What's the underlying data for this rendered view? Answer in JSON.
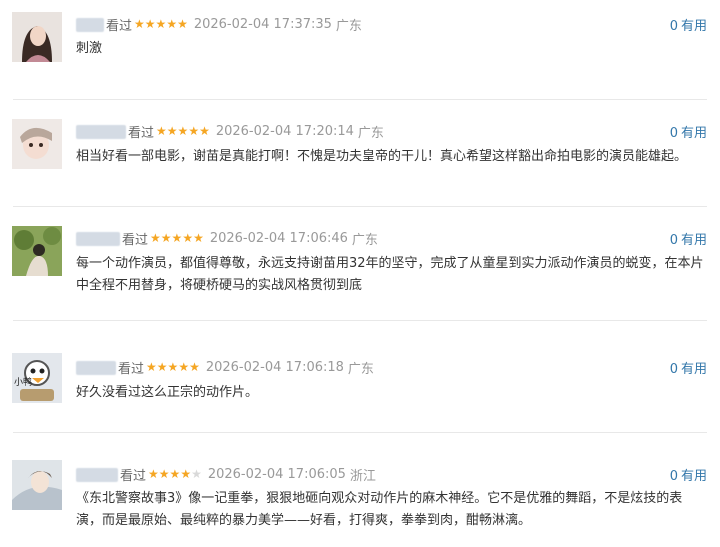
{
  "comments": [
    {
      "status": "看过",
      "stars": 5,
      "time": "2026-02-04 17:37:35",
      "location": "广东",
      "useful_count": "0",
      "useful_label": "有用",
      "text": "刺激"
    },
    {
      "status": "看过",
      "stars": 5,
      "time": "2026-02-04 17:20:14",
      "location": "广东",
      "useful_count": "0",
      "useful_label": "有用",
      "text": "相当好看一部电影，谢苗是真能打啊！不愧是功夫皇帝的干儿！真心希望这样豁出命拍电影的演员能雄起。"
    },
    {
      "status": "看过",
      "stars": 5,
      "time": "2026-02-04 17:06:46",
      "location": "广东",
      "useful_count": "0",
      "useful_label": "有用",
      "text": "每一个动作演员，都值得尊敬，永远支持谢苗用32年的坚守，完成了从童星到实力派动作演员的蜕变，在本片中全程不用替身，将硬桥硬马的实战风格贯彻到底"
    },
    {
      "status": "看过",
      "stars": 5,
      "time": "2026-02-04 17:06:18",
      "location": "广东",
      "useful_count": "0",
      "useful_label": "有用",
      "text": "好久没看过这么正宗的动作片。",
      "avatar_text": "小鸭"
    },
    {
      "status": "看过",
      "stars": 4,
      "time": "2026-02-04 17:06:05",
      "location": "浙江",
      "useful_count": "0",
      "useful_label": "有用",
      "text": "《东北警察故事3》像一记重拳，狠狠地砸向观众对动作片的麻木神经。它不是优雅的舞蹈，不是炫技的表演，而是最原始、最纯粹的暴力美学——好看，打得爽，拳拳到肉，酣畅淋漓。"
    }
  ],
  "colors": {
    "star": "#f5a623",
    "link": "#3377aa",
    "divider": "#e8e8e8"
  }
}
